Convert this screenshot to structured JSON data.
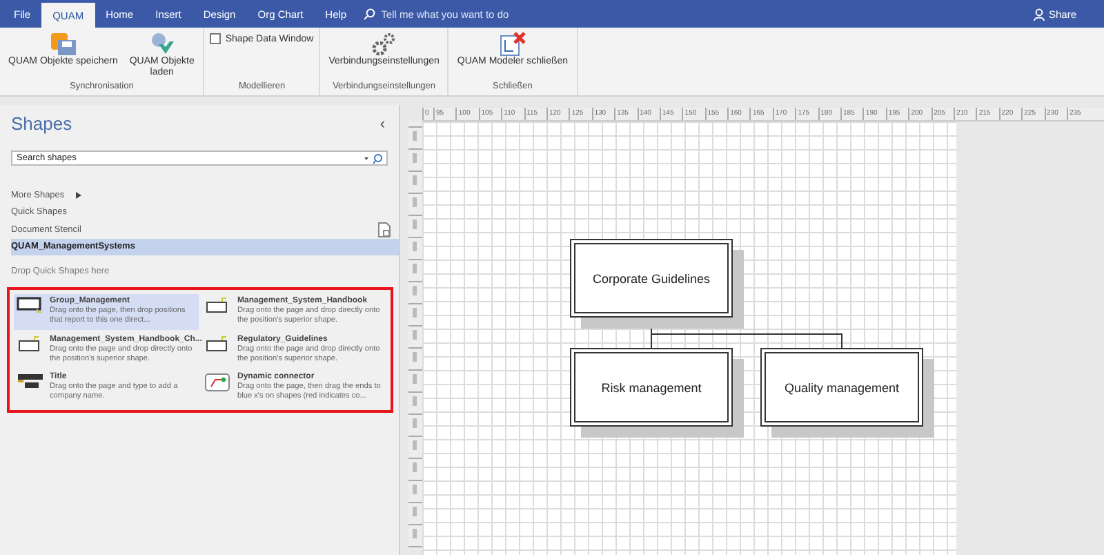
{
  "ribbon_tabs": [
    {
      "label": "File",
      "selected": false
    },
    {
      "label": "QUAM",
      "selected": true
    },
    {
      "label": "Home",
      "selected": false
    },
    {
      "label": "Insert",
      "selected": false
    },
    {
      "label": "Design",
      "selected": false
    },
    {
      "label": "Org Chart",
      "selected": false
    },
    {
      "label": "Help",
      "selected": false
    }
  ],
  "tell_me": {
    "placeholder": "Tell me what you want to do"
  },
  "share": "Share",
  "ribbon_groups": [
    {
      "label": "Synchronisation",
      "controls": [
        {
          "kind": "save",
          "label": "QUAM Objekte speichern"
        },
        {
          "kind": "load",
          "label": "QUAM Objekte laden"
        }
      ]
    },
    {
      "label": "Modellieren",
      "controls": [
        {
          "kind": "checkbox",
          "label": "Shape Data Window",
          "checked": false
        }
      ]
    },
    {
      "label": "Verbindungseinstellungen",
      "controls": [
        {
          "kind": "gears",
          "label": "Verbindungseinstellungen"
        }
      ]
    },
    {
      "label": "Schließen",
      "controls": [
        {
          "kind": "close",
          "label": "QUAM Modeler schließen"
        }
      ]
    }
  ],
  "shapes_panel": {
    "title": "Shapes",
    "collapse": "‹",
    "search": {
      "placeholder": "Search shapes"
    },
    "nav": [
      {
        "label": "More Shapes",
        "kind": "submenu",
        "selected": false
      },
      {
        "label": "Quick Shapes",
        "kind": "plain",
        "selected": false
      },
      {
        "label": "Document Stencil",
        "kind": "stencil",
        "selected": false
      },
      {
        "label": "QUAM_ManagementSystems",
        "kind": "plain",
        "selected": true
      }
    ],
    "drop_hint": "Drop Quick Shapes here",
    "shapes": [
      {
        "name": "Group_Management",
        "description": "Drag onto the page, then drop positions that report to this one direct...",
        "kind": "monitor",
        "selected": true
      },
      {
        "name": "Management_System_Handbook",
        "description": "Drag onto the page and drop directly onto the position's superior shape.",
        "kind": "box",
        "selected": false
      },
      {
        "name": "Management_System_Handbook_Ch...",
        "description": "Drag onto the page and drop directly onto the position's superior shape.",
        "kind": "box",
        "selected": false
      },
      {
        "name": "Regulatory_Guidelines",
        "description": "Drag onto the page and drop directly onto the position's superior shape.",
        "kind": "box",
        "selected": false
      },
      {
        "name": "Title",
        "description": "Drag onto the page and type to add a company name.",
        "kind": "title",
        "selected": false
      },
      {
        "name": "Dynamic connector",
        "description": "Drag onto the page, then drag the ends to blue x's on shapes (red indicates co...",
        "kind": "connector",
        "selected": false
      }
    ]
  },
  "ruler_labels": [
    "0",
    "95",
    "100",
    "105",
    "110",
    "115",
    "120",
    "125",
    "130",
    "135",
    "140",
    "145",
    "150",
    "155",
    "160",
    "165",
    "170",
    "175",
    "180",
    "185",
    "190",
    "195",
    "200",
    "205",
    "210",
    "215",
    "220",
    "225",
    "230",
    "235"
  ],
  "diagram": {
    "nodes": [
      {
        "label": "Corporate Guidelines"
      },
      {
        "label": "Risk management"
      },
      {
        "label": "Quality management"
      }
    ]
  }
}
